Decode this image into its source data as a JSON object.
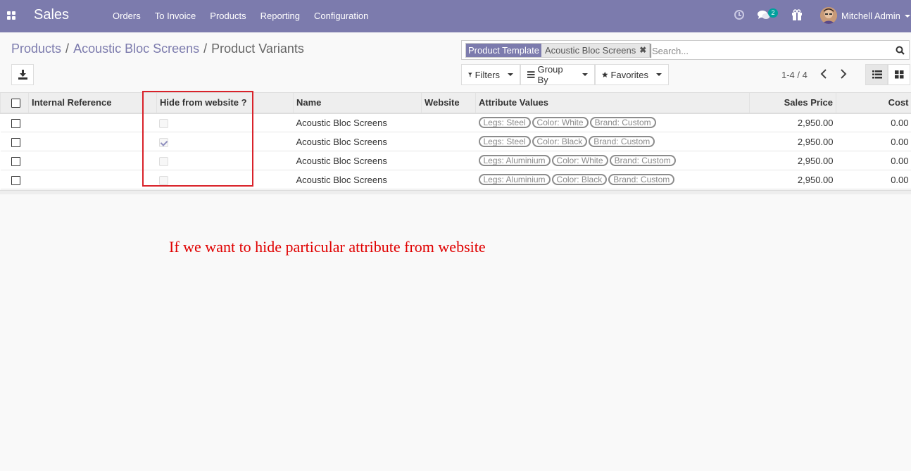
{
  "navbar": {
    "app_title": "Sales",
    "menu": [
      "Orders",
      "To Invoice",
      "Products",
      "Reporting",
      "Configuration"
    ],
    "chat_badge": "2",
    "user_name": "Mitchell Admin",
    "icons": [
      "apps-icon",
      "clock-icon",
      "chat-icon",
      "gift-icon",
      "avatar"
    ]
  },
  "breadcrumb": {
    "items": [
      "Products",
      "Acoustic Bloc Screens"
    ],
    "sep": "/",
    "active": "Product Variants"
  },
  "search": {
    "facet_label": "Product Template",
    "facet_value": "Acoustic Bloc Screens",
    "facet_close": "✖",
    "placeholder": "Search..."
  },
  "controls": {
    "filters": "Filters",
    "group_by": "Group By",
    "favorites": "Favorites",
    "pager": "1-4 / 4"
  },
  "table": {
    "columns": [
      "Internal Reference",
      "Hide from website ?",
      "Name",
      "Website",
      "Attribute Values",
      "Sales Price",
      "Cost"
    ],
    "rows": [
      {
        "hide": false,
        "name": "Acoustic Bloc Screens",
        "attrs": [
          "Legs: Steel",
          "Color: White",
          "Brand: Custom"
        ],
        "price": "2,950.00",
        "cost": "0.00"
      },
      {
        "hide": true,
        "name": "Acoustic Bloc Screens",
        "attrs": [
          "Legs: Steel",
          "Color: Black",
          "Brand: Custom"
        ],
        "price": "2,950.00",
        "cost": "0.00"
      },
      {
        "hide": false,
        "name": "Acoustic Bloc Screens",
        "attrs": [
          "Legs: Aluminium",
          "Color: White",
          "Brand: Custom"
        ],
        "price": "2,950.00",
        "cost": "0.00"
      },
      {
        "hide": false,
        "name": "Acoustic Bloc Screens",
        "attrs": [
          "Legs: Aluminium",
          "Color: Black",
          "Brand: Custom"
        ],
        "price": "2,950.00",
        "cost": "0.00"
      }
    ]
  },
  "annotation": "If we want to hide particular attribute from website",
  "colors": {
    "brand": "#7c7bad",
    "badge": "#00a09d",
    "annotation": "#e00000"
  }
}
